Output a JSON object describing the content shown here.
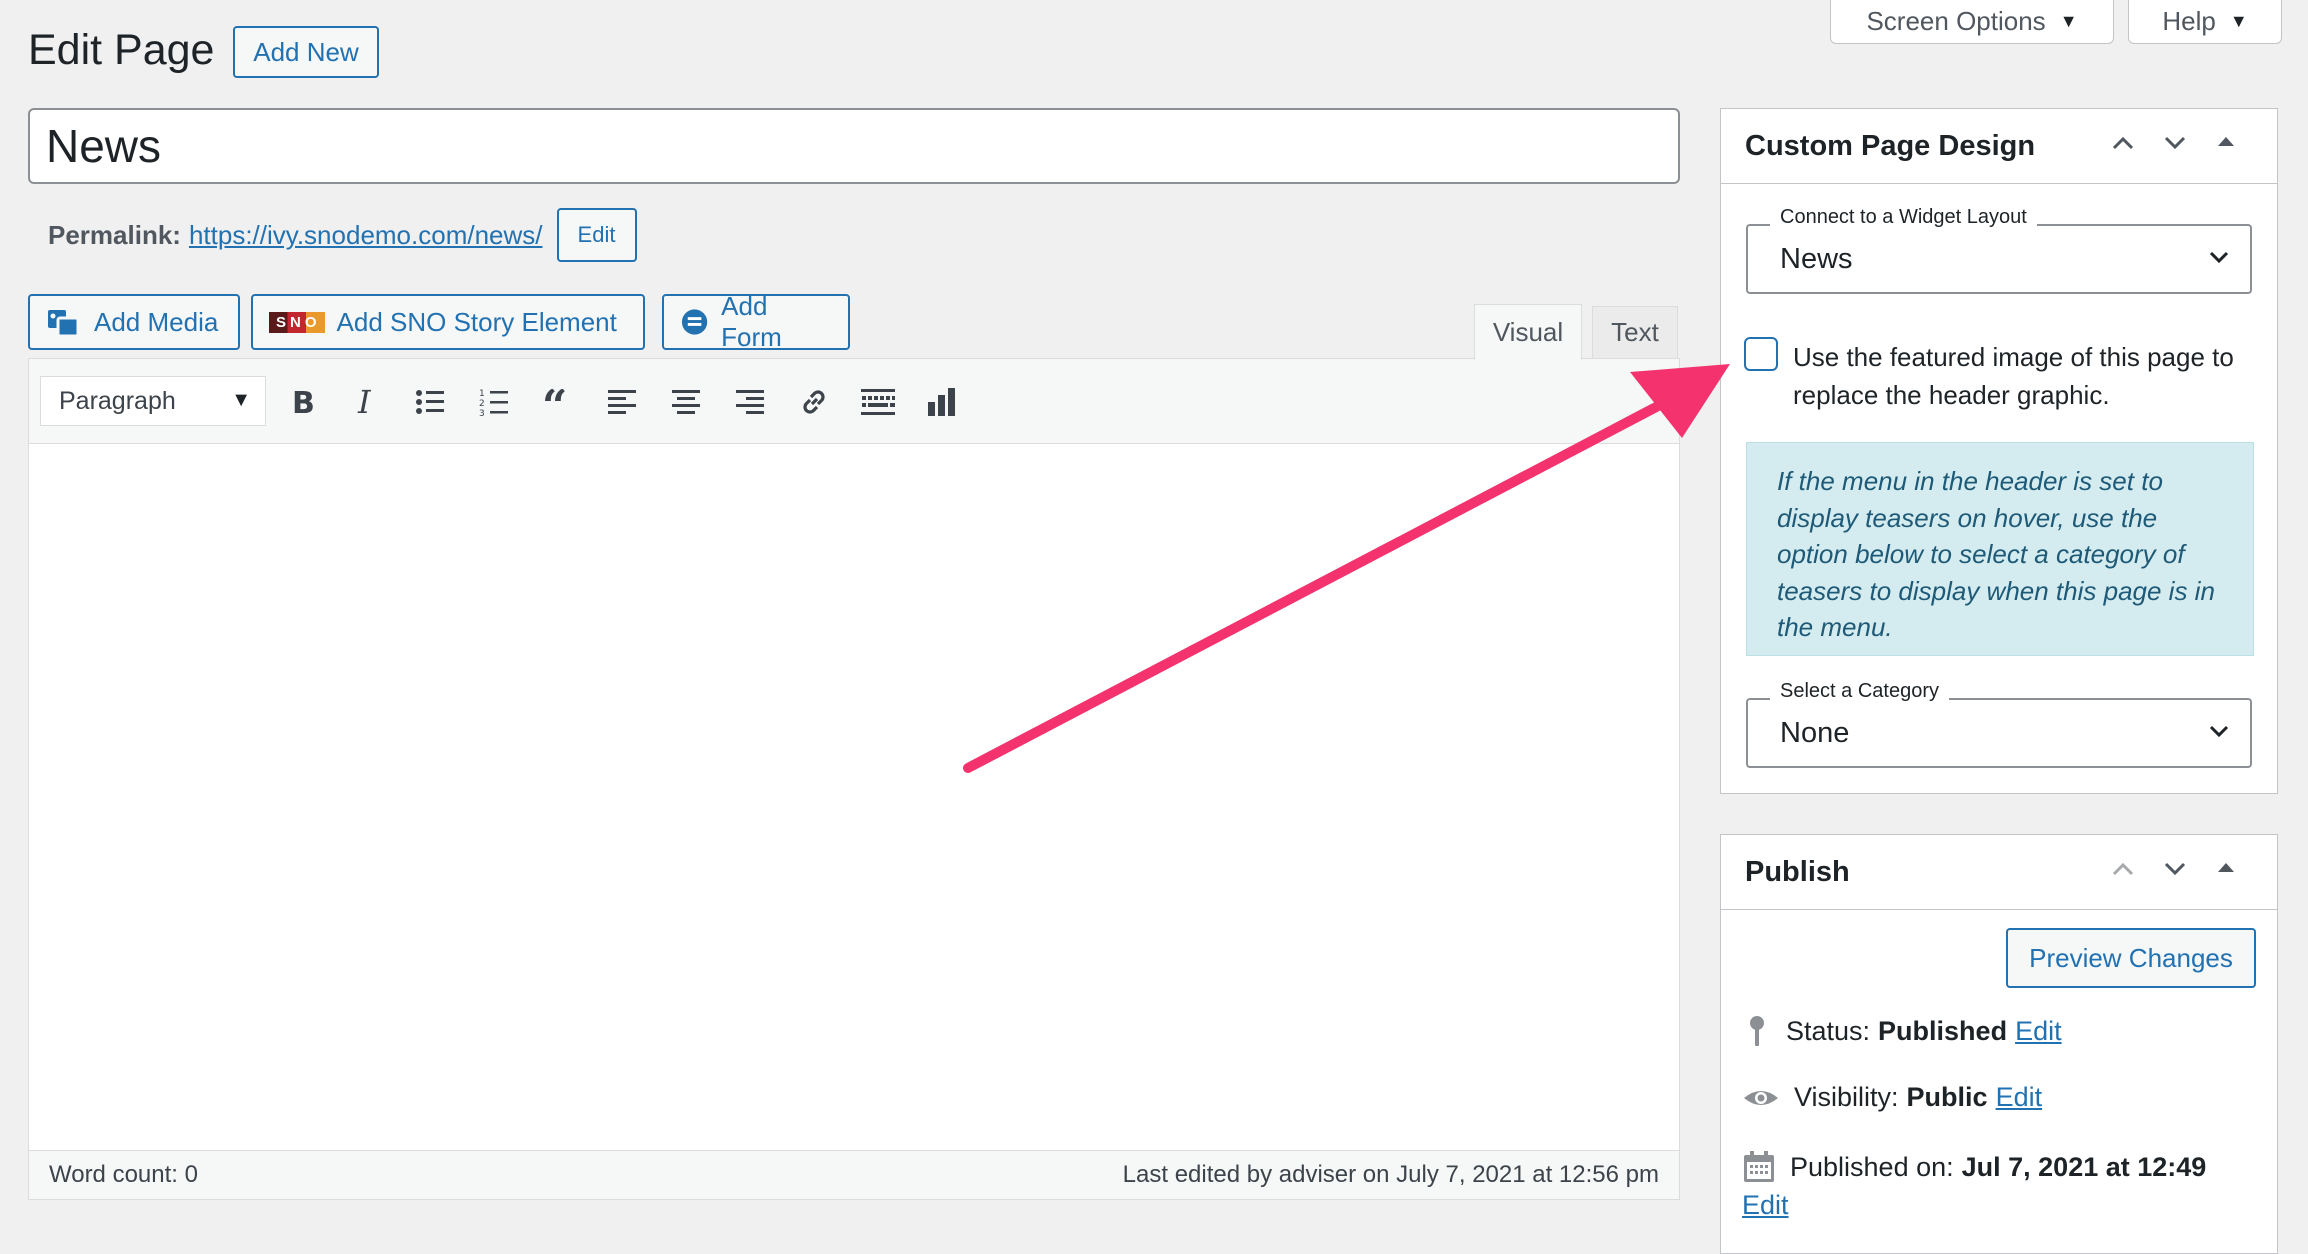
{
  "screen_meta": {
    "screen_options": "Screen Options",
    "help": "Help"
  },
  "header": {
    "title": "Edit Page",
    "add_new": "Add New"
  },
  "post_title": "News",
  "permalink": {
    "label": "Permalink:",
    "url": "https://ivy.snodemo.com/news/",
    "edit": "Edit"
  },
  "media_buttons": {
    "add_media": "Add Media",
    "add_sno": "Add SNO Story Element",
    "sno_logo": "SNO",
    "add_form": "Add Form"
  },
  "editor_tabs": {
    "visual": "Visual",
    "text": "Text"
  },
  "toolbar": {
    "format": "Paragraph",
    "icons": [
      "bold-icon",
      "italic-icon",
      "bullet-list-icon",
      "numbered-list-icon",
      "blockquote-icon",
      "align-left-icon",
      "align-center-icon",
      "align-right-icon",
      "link-icon",
      "keyboard-icon",
      "chart-icon"
    ]
  },
  "status_bar": {
    "word_count": "Word count: 0",
    "last_edited": "Last edited by adviser on July 7, 2021 at 12:56 pm"
  },
  "custom_design": {
    "title": "Custom Page Design",
    "widget_legend": "Connect to a Widget Layout",
    "widget_value": "News",
    "featured_label": "Use the featured image of this page to replace the header graphic.",
    "featured_checked": false,
    "notice": "If the menu in the header is set to display teasers on hover, use the option below to select a category of teasers to display when this page is in the menu.",
    "category_legend": "Select a Category",
    "category_value": "None"
  },
  "publish": {
    "title": "Publish",
    "preview": "Preview Changes",
    "status_label": "Status:",
    "status_value": "Published",
    "status_edit": "Edit",
    "visibility_label": "Visibility:",
    "visibility_value": "Public",
    "visibility_edit": "Edit",
    "published_label": "Published on:",
    "published_value": "Jul 7, 2021 at 12:49",
    "published_edit": "Edit"
  },
  "colors": {
    "accent": "#2271b1",
    "annotation_arrow": "#f4336e",
    "notice_bg": "#d4ecef"
  }
}
